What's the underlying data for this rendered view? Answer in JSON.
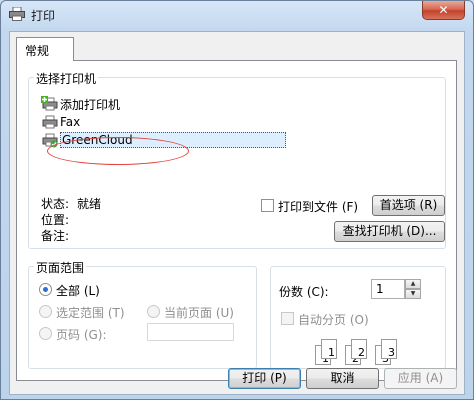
{
  "window": {
    "title": "打印",
    "close_label": "✕"
  },
  "tabs": [
    {
      "label": "常规"
    }
  ],
  "printer_group": {
    "label": "选择打印机",
    "printers": [
      {
        "name": "添加打印机",
        "icon": "add-printer-icon"
      },
      {
        "name": "Fax",
        "icon": "fax-printer-icon"
      },
      {
        "name": "GreenCloud",
        "icon": "printer-ready-icon",
        "selected": true
      }
    ],
    "status_label": "状态:",
    "status_value": "就绪",
    "location_label": "位置:",
    "comment_label": "备注:",
    "print_to_file_label": "打印到文件 (F)",
    "preferences_label": "首选项 (R)",
    "find_printer_label": "查找打印机 (D)..."
  },
  "page_range": {
    "label": "页面范围",
    "all_label": "全部 (L)",
    "selection_label": "选定范围 (T)",
    "current_label": "当前页面 (U)",
    "pages_label": "页码 (G):",
    "pages_value": ""
  },
  "copies": {
    "label": "份数 (C):",
    "value": "1",
    "collate_label": "自动分页 (O)"
  },
  "buttons": {
    "print_label": "打印 (P)",
    "cancel_label": "取消",
    "apply_label": "应用 (A)"
  },
  "colors": {
    "annotation": "#e0443a",
    "selection": "#ddeeff"
  }
}
